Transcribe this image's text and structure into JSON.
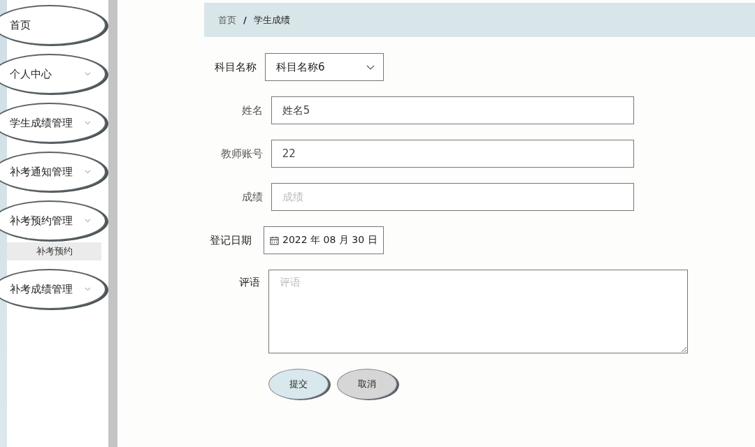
{
  "sidebar": {
    "menu": [
      {
        "label": "首页",
        "kind": "link"
      },
      {
        "label": "个人中心",
        "kind": "group"
      },
      {
        "label": "学生成绩管理",
        "kind": "group"
      },
      {
        "label": "补考通知管理",
        "kind": "group"
      },
      {
        "label": "补考预约管理",
        "kind": "group",
        "children": [
          {
            "label": "补考预约",
            "selected": true
          }
        ]
      },
      {
        "label": "补考成绩管理",
        "kind": "group"
      }
    ]
  },
  "breadcrumb": [
    "首页",
    "学生成绩"
  ],
  "breadcrumb_separator": "/",
  "form": {
    "fields": [
      {
        "kind": "select",
        "label": "科目名称",
        "value": "科目名称6"
      },
      {
        "kind": "input",
        "label": "姓名",
        "value": "姓名5"
      },
      {
        "kind": "input",
        "label": "教师账号",
        "value": "22"
      },
      {
        "kind": "input",
        "label": "成绩",
        "placeholder": "成绩"
      },
      {
        "kind": "date",
        "label": "登记日期",
        "value": "2022 年 08 月 30 日"
      },
      {
        "kind": "textarea",
        "label": "评语",
        "placeholder": "评语"
      }
    ],
    "buttons": [
      {
        "label": "提交",
        "kind": "primary"
      },
      {
        "label": "取消",
        "kind": "secondary"
      }
    ]
  }
}
